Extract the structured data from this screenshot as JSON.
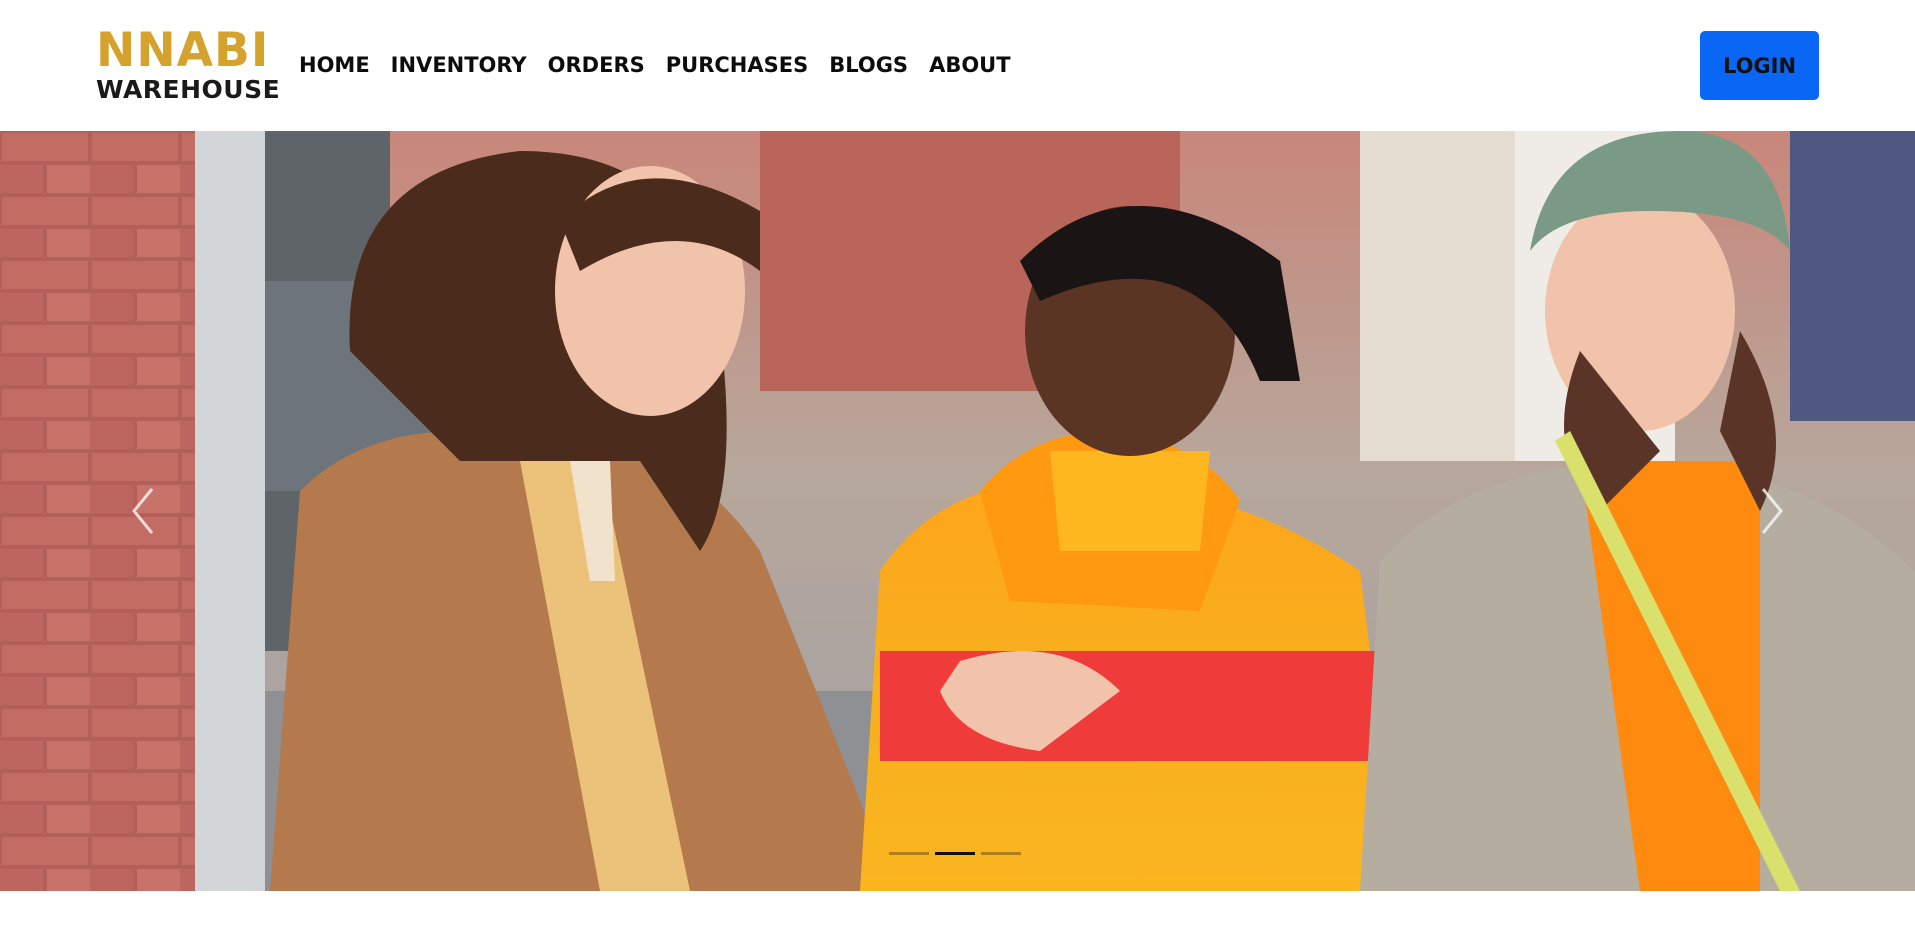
{
  "brand": {
    "name_top": "NNABI",
    "name_bottom": "WAREHOUSE"
  },
  "nav": {
    "items": [
      {
        "label": "HOME"
      },
      {
        "label": "INVENTORY"
      },
      {
        "label": "ORDERS"
      },
      {
        "label": "PURCHASES"
      },
      {
        "label": "BLOGS"
      },
      {
        "label": "ABOUT"
      }
    ]
  },
  "login": {
    "label": "LOGIN"
  },
  "carousel": {
    "prev_icon": "chevron-left-icon",
    "next_icon": "chevron-right-icon",
    "indicator_count": 3,
    "active_index": 1
  },
  "colors": {
    "brand_gold": "#d4a22d",
    "login_blue": "#0a66f5"
  }
}
